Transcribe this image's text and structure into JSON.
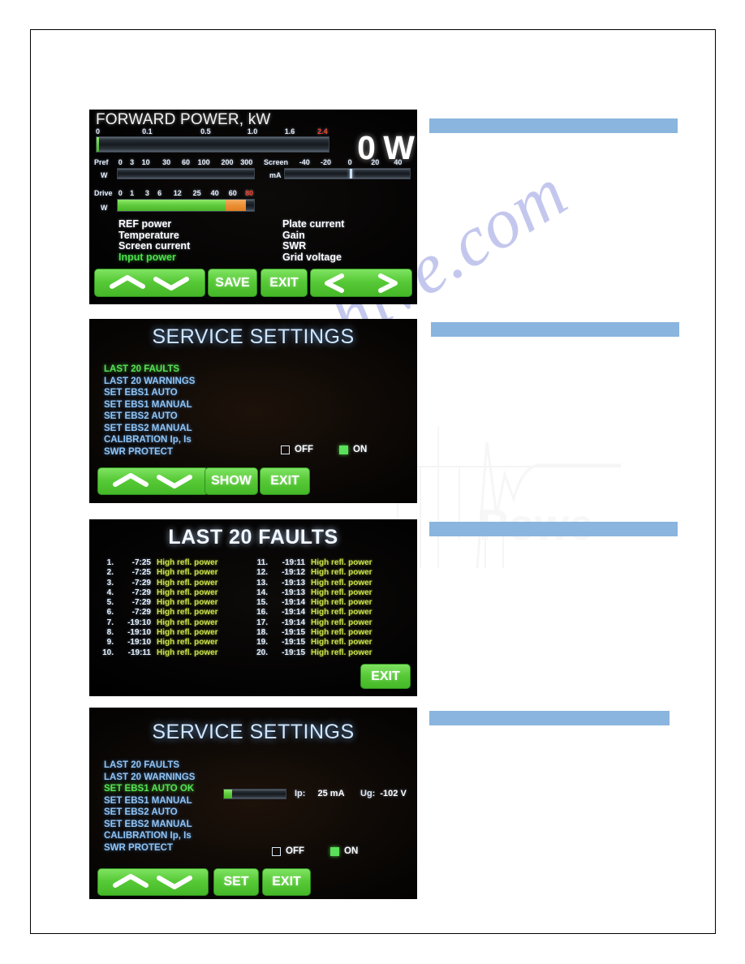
{
  "document": {
    "watermark_text": "manualshive.com",
    "watermark_logo_name": "waveform-logo-watermark"
  },
  "redacted_bars": [
    {
      "name": "redacted-caption-1"
    },
    {
      "name": "redacted-caption-2"
    },
    {
      "name": "redacted-caption-3"
    },
    {
      "name": "redacted-caption-4"
    }
  ],
  "colors": {
    "button_green": "#58ca38",
    "selected_green": "#4ce04c",
    "heading_blue": "#cfe6ff",
    "menu_blue": "#8fc4f5",
    "fault_yellow": "#c8e04a",
    "alarm_red": "#f0452a",
    "redacted_blue": "#8ab5de",
    "drive_orange": "#ec8f35"
  },
  "panel1": {
    "title": "FORWARD POWER, kW",
    "forward": {
      "ticks": [
        "0",
        "0.1",
        "0.5",
        "1.0",
        "1.6",
        "2.4"
      ],
      "tick_positions": [
        0,
        22,
        47,
        67,
        83,
        97
      ],
      "red_tick_index": 5,
      "fill_percent": 1
    },
    "readout": "0 W",
    "pref": {
      "label": "Pref",
      "unit": "W",
      "ticks": [
        "0",
        "3",
        "10",
        "30",
        "60",
        "100",
        "200",
        "300"
      ],
      "tick_positions": [
        1,
        11,
        21,
        36,
        50,
        63,
        80,
        94
      ],
      "fill_percent": 0
    },
    "screen": {
      "label": "Screen",
      "unit": "mA",
      "ticks": [
        "-40",
        "-20",
        "0",
        "20",
        "40"
      ],
      "tick_positions": [
        12,
        33,
        52,
        72,
        90
      ],
      "marker_percent": 52
    },
    "drive": {
      "label": "Drive",
      "unit": "W",
      "ticks": [
        "0",
        "1",
        "3",
        "6",
        "12",
        "25",
        "40",
        "60",
        "80"
      ],
      "tick_positions": [
        1,
        11,
        22,
        31,
        44,
        58,
        71,
        84,
        96
      ],
      "red_tick_index": 8,
      "green_percent": 79,
      "orange_start": 79,
      "orange_percent": 15
    },
    "menu_left": [
      {
        "label": "REF power",
        "selected": false
      },
      {
        "label": "Temperature",
        "selected": false
      },
      {
        "label": "Screen current",
        "selected": false
      },
      {
        "label": "Input power",
        "selected": true
      }
    ],
    "menu_right": [
      {
        "label": "Plate current",
        "selected": false
      },
      {
        "label": "Gain",
        "selected": false
      },
      {
        "label": "SWR",
        "selected": false
      },
      {
        "label": "Grid voltage",
        "selected": false
      }
    ],
    "buttons": {
      "up": "chevron-up-icon",
      "down": "chevron-down-icon",
      "save": "SAVE",
      "exit": "EXIT",
      "left": "chevron-left-icon",
      "right": "chevron-right-icon"
    }
  },
  "panel2": {
    "title": "SERVICE SETTINGS",
    "items": [
      {
        "label": "LAST 20 FAULTS",
        "selected": true
      },
      {
        "label": "LAST 20 WARNINGS",
        "selected": false
      },
      {
        "label": "SET EBS1 AUTO",
        "selected": false
      },
      {
        "label": "SET EBS1 MANUAL",
        "selected": false
      },
      {
        "label": "SET EBS2 AUTO",
        "selected": false
      },
      {
        "label": "SET EBS2 MANUAL",
        "selected": false
      },
      {
        "label": "CALIBRATION Ip, Is",
        "selected": false
      },
      {
        "label": "SWR PROTECT",
        "selected": false
      }
    ],
    "swr_protect": {
      "off_label": "OFF",
      "off_checked": false,
      "on_label": "ON",
      "on_checked": true
    },
    "buttons": {
      "up": "chevron-up-icon",
      "down": "chevron-down-icon",
      "show": "SHOW",
      "exit": "EXIT"
    }
  },
  "panel3": {
    "title": "LAST 20 FAULTS",
    "exit_label": "EXIT",
    "faults_left": [
      {
        "index": "1.",
        "time": "-7:25",
        "message": "High refl. power"
      },
      {
        "index": "2.",
        "time": "-7:25",
        "message": "High refl. power"
      },
      {
        "index": "3.",
        "time": "-7:29",
        "message": "High refl. power"
      },
      {
        "index": "4.",
        "time": "-7:29",
        "message": "High refl. power"
      },
      {
        "index": "5.",
        "time": "-7:29",
        "message": "High refl. power"
      },
      {
        "index": "6.",
        "time": "-7:29",
        "message": "High refl. power"
      },
      {
        "index": "7.",
        "time": "-19:10",
        "message": "High refl. power"
      },
      {
        "index": "8.",
        "time": "-19:10",
        "message": "High refl. power"
      },
      {
        "index": "9.",
        "time": "-19:10",
        "message": "High refl. power"
      },
      {
        "index": "10.",
        "time": "-19:11",
        "message": "High refl. power"
      }
    ],
    "faults_right": [
      {
        "index": "11.",
        "time": "-19:11",
        "message": "High refl. power"
      },
      {
        "index": "12.",
        "time": "-19:12",
        "message": "High refl. power"
      },
      {
        "index": "13.",
        "time": "-19:13",
        "message": "High refl. power"
      },
      {
        "index": "14.",
        "time": "-19:13",
        "message": "High refl. power"
      },
      {
        "index": "15.",
        "time": "-19:14",
        "message": "High refl. power"
      },
      {
        "index": "16.",
        "time": "-19:14",
        "message": "High refl. power"
      },
      {
        "index": "17.",
        "time": "-19:14",
        "message": "High refl. power"
      },
      {
        "index": "18.",
        "time": "-19:15",
        "message": "High refl. power"
      },
      {
        "index": "19.",
        "time": "-19:15",
        "message": "High refl. power"
      },
      {
        "index": "20.",
        "time": "-19:15",
        "message": "High refl. power"
      }
    ]
  },
  "panel4": {
    "title": "SERVICE SETTINGS",
    "items": [
      {
        "label": "LAST 20 FAULTS",
        "selected": false
      },
      {
        "label": "LAST 20 WARNINGS",
        "selected": false
      },
      {
        "label": "SET EBS1 AUTO OK",
        "selected": true
      },
      {
        "label": "SET EBS1 MANUAL",
        "selected": false
      },
      {
        "label": "SET EBS2 AUTO",
        "selected": false
      },
      {
        "label": "SET EBS2 MANUAL",
        "selected": false
      },
      {
        "label": "CALIBRATION Ip, Is",
        "selected": false
      },
      {
        "label": "SWR PROTECT",
        "selected": false
      }
    ],
    "ebs_bar_fill_percent": 13,
    "measurements": {
      "ip_label": "Ip:",
      "ip_value": "25 mA",
      "ug_label": "Ug:",
      "ug_value": "-102 V"
    },
    "swr_protect": {
      "off_label": "OFF",
      "off_checked": false,
      "on_label": "ON",
      "on_checked": true
    },
    "buttons": {
      "up": "chevron-up-icon",
      "down": "chevron-down-icon",
      "set": "SET",
      "exit": "EXIT"
    }
  }
}
